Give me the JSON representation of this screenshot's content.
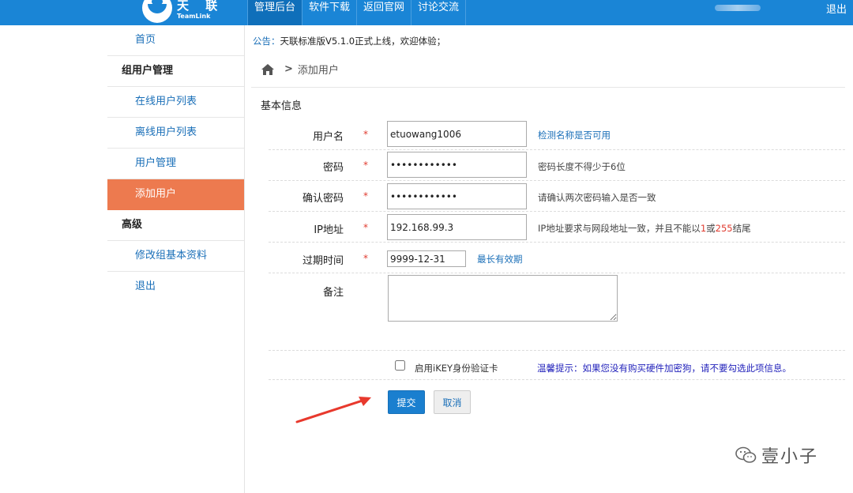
{
  "header": {
    "logo_cn": "天 联",
    "logo_en": "TeamLink",
    "nav": [
      {
        "label": "管理后台",
        "active": true
      },
      {
        "label": "软件下载",
        "active": false
      },
      {
        "label": "返回官网",
        "active": false
      },
      {
        "label": "讨论交流",
        "active": false
      }
    ],
    "logout": "退出"
  },
  "sidebar": {
    "items": [
      {
        "label": "首页"
      },
      {
        "label": "组用户管理"
      },
      {
        "label": "在线用户列表"
      },
      {
        "label": "离线用户列表"
      },
      {
        "label": "用户管理"
      },
      {
        "label": "添加用户"
      },
      {
        "label": "高级"
      },
      {
        "label": "修改组基本资料"
      },
      {
        "label": "退出"
      }
    ]
  },
  "notice": {
    "label": "公告：",
    "text": "天联标准版V5.1.0正式上线，欢迎体验；"
  },
  "breadcrumb": {
    "separator": ">",
    "current": "添加用户"
  },
  "form": {
    "section_title": "基本信息",
    "required_mark": "*",
    "username": {
      "label": "用户名",
      "value": "etuowang1006",
      "hint": "检测名称是否可用"
    },
    "password": {
      "label": "密码",
      "value": "xxxxxxxxxxxx",
      "hint": "密码长度不得少于6位"
    },
    "confirm": {
      "label": "确认密码",
      "value": "xxxxxxxxxxxx",
      "hint": "请确认两次密码输入是否一致"
    },
    "ip": {
      "label": "IP地址",
      "value": "192.168.99.3",
      "hint_pre": "IP地址要求与网段地址一致，并且不能以",
      "hint_n1": "1",
      "hint_mid": "或",
      "hint_n2": "255",
      "hint_post": "结尾"
    },
    "expire": {
      "label": "过期时间",
      "value": "9999-12-31",
      "hint": "最长有效期"
    },
    "remark": {
      "label": "备注",
      "value": ""
    },
    "ikey": {
      "label": "启用iKEY身份验证卡",
      "checked": false
    },
    "tip": "温馨提示：如果您没有购买硬件加密狗，请不要勾选此项信息。",
    "submit": "提交",
    "cancel": "取消"
  },
  "watermark": "壹小子",
  "colors": {
    "topbar": "#1a85d6",
    "active_sidebar": "#ed7a4f",
    "link": "#1a6fb8",
    "required": "#e03b2f"
  }
}
